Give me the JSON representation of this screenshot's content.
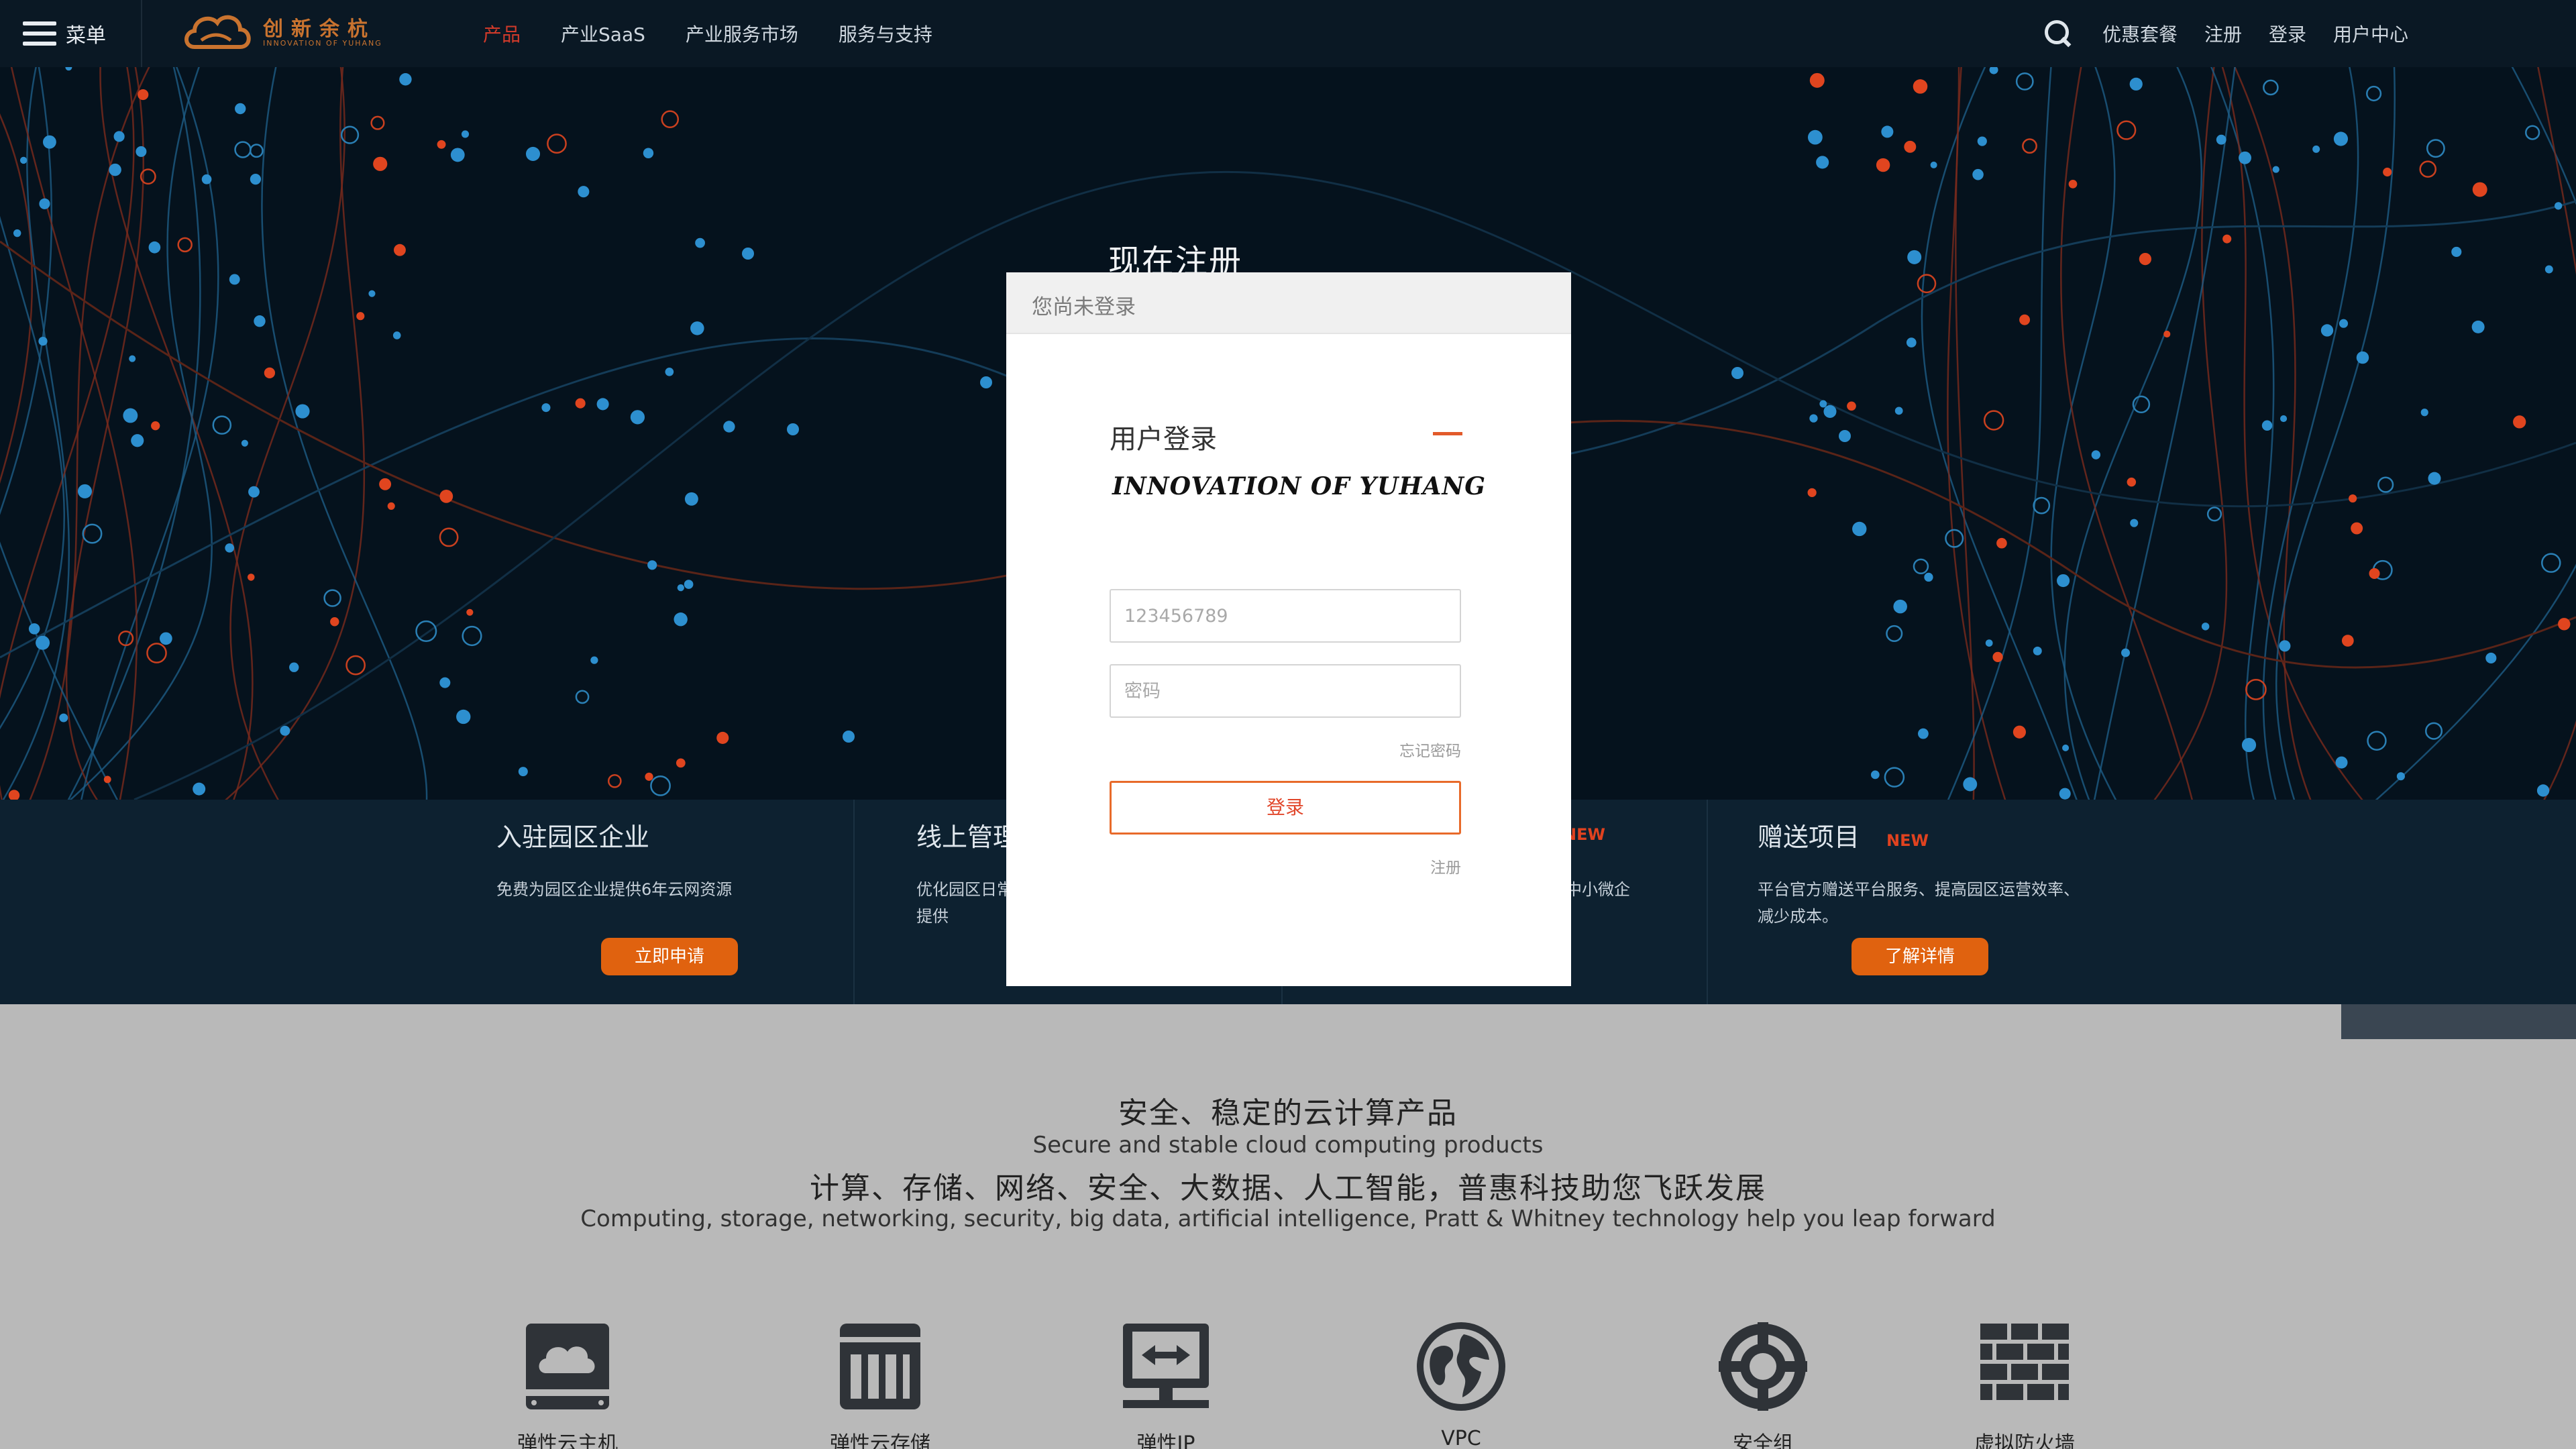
{
  "nav": {
    "menu_label": "菜单",
    "logo_text": "创新余杭",
    "logo_sub": "INNOVATION OF YUHANG",
    "links": [
      "产品",
      "产业SaaS",
      "产业服务市场",
      "服务与支持"
    ],
    "right_links": [
      "优惠套餐",
      "注册",
      "登录",
      "用户中心"
    ]
  },
  "hero": {
    "title": "现在注册"
  },
  "features": [
    {
      "title": "入驻园区企业",
      "badge": "",
      "desc": "免费为园区企业提供6年云网资源",
      "button": "立即申请"
    },
    {
      "title": "线上管理",
      "badge": "",
      "desc": "优化园区日常管理，平台可提供",
      "button": ""
    },
    {
      "title": "",
      "badge": "NEW",
      "desc": "中小微企",
      "button": ""
    },
    {
      "title": "赠送项目",
      "badge": "NEW",
      "desc": "平台官方赠送平台服务、提高园区运营效率、减少成本。",
      "button": "了解详情"
    }
  ],
  "lower": {
    "heading_cn": "安全、稳定的云计算产品",
    "heading_en": "Secure and stable cloud computing products",
    "sub_cn": "计算、存储、网络、安全、大数据、人工智能，普惠科技助您飞跃发展",
    "sub_en": "Computing, storage, networking, security, big data, artificial intelligence, Pratt & Whitney technology help you leap forward",
    "products": [
      {
        "label": "弹性云主机",
        "icon": "cloud-host-icon"
      },
      {
        "label": "弹性云存储",
        "icon": "cloud-storage-icon"
      },
      {
        "label": "弹性IP",
        "icon": "elastic-ip-icon"
      },
      {
        "label": "VPC",
        "icon": "globe-icon"
      },
      {
        "label": "安全组",
        "icon": "lifebuoy-icon"
      },
      {
        "label": "虚拟防火墙",
        "icon": "firewall-icon"
      }
    ]
  },
  "modal": {
    "header": "您尚未登录",
    "title": "用户登录",
    "slogan": "INNOVATION OF YUHANG",
    "username_value": "123456789",
    "username_placeholder": "123456789",
    "password_placeholder": "密码",
    "forgot": "忘记密码",
    "login_button": "登录",
    "register": "注册"
  },
  "colors": {
    "nav_bg": "#0a1824",
    "hero_bg": "#05121d",
    "accent": "#e0620f",
    "active_link": "#d13a2a"
  }
}
